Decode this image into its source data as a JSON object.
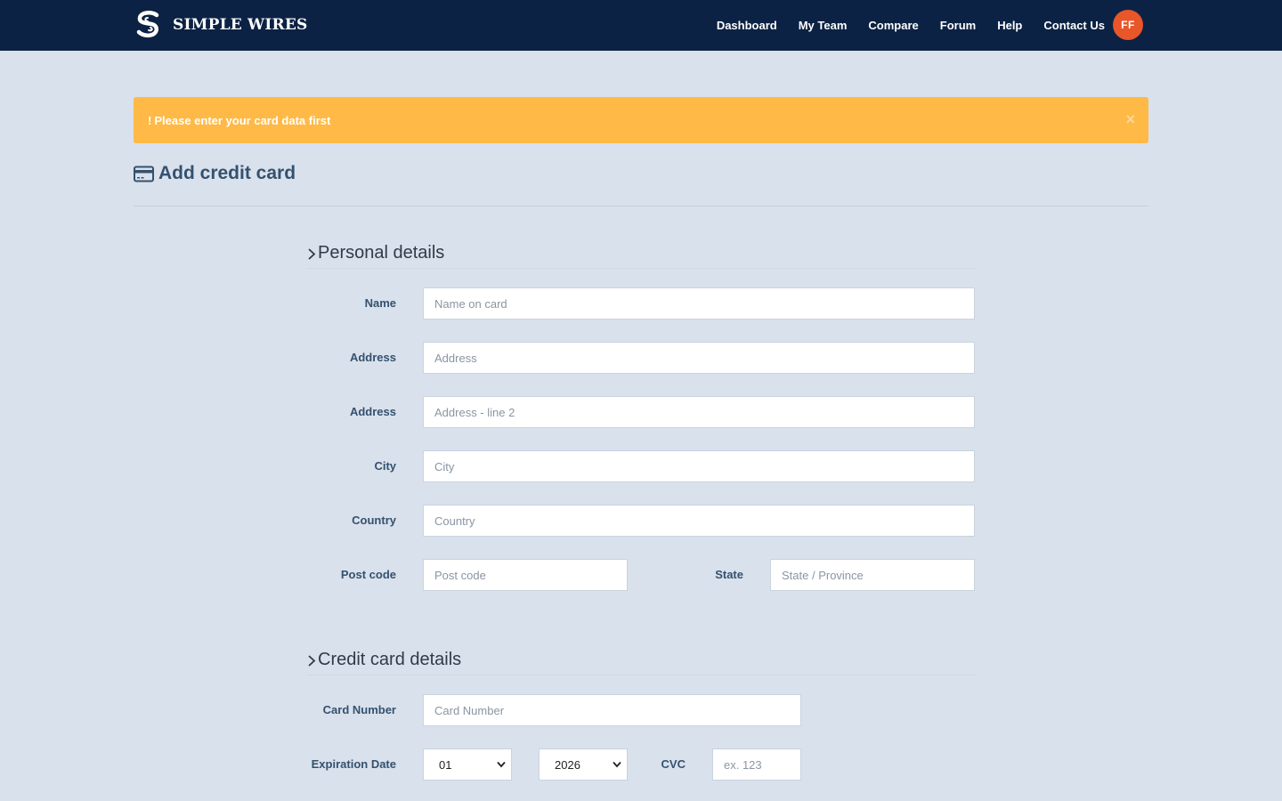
{
  "nav": {
    "brand": "SIMPLE WIRES",
    "links": [
      "Dashboard",
      "My Team",
      "Compare",
      "Forum",
      "Help",
      "Contact Us"
    ],
    "avatar_initials": "FF"
  },
  "alert": {
    "icon": "!",
    "message": "Please enter your card data first",
    "close": "×"
  },
  "page": {
    "title": "Add credit card"
  },
  "personal": {
    "heading": "Personal details",
    "name": {
      "label": "Name",
      "placeholder": "Name on card"
    },
    "address1": {
      "label": "Address",
      "placeholder": "Address"
    },
    "address2": {
      "label": "Address",
      "placeholder": "Address - line 2"
    },
    "city": {
      "label": "City",
      "placeholder": "City"
    },
    "country": {
      "label": "Country",
      "placeholder": "Country"
    },
    "postcode": {
      "label": "Post code",
      "placeholder": "Post code"
    },
    "state": {
      "label": "State",
      "placeholder": "State / Province"
    }
  },
  "card": {
    "heading": "Credit card details",
    "number": {
      "label": "Card Number",
      "placeholder": "Card Number"
    },
    "expiration": {
      "label": "Expiration Date",
      "month": "01",
      "year": "2026"
    },
    "cvc": {
      "label": "CVC",
      "placeholder": "ex. 123"
    }
  },
  "colors": {
    "navbar": "#0c2244",
    "background": "#d9e1ec",
    "alert": "#ffb946",
    "avatar": "#e8562a",
    "label": "#34516f"
  }
}
